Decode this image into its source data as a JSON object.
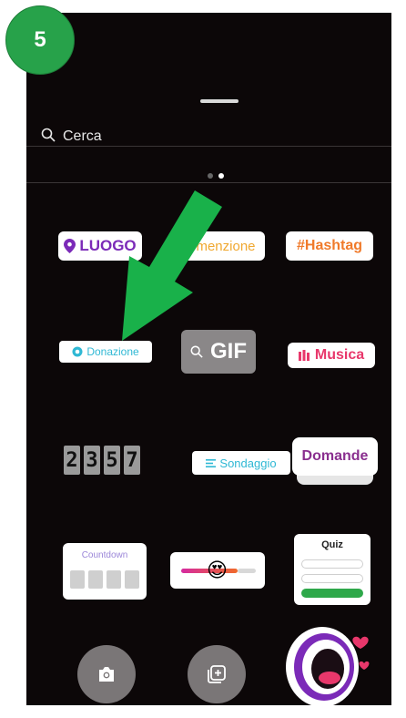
{
  "step_badge": "5",
  "search": {
    "placeholder": "Cerca",
    "icon": "search-icon"
  },
  "pager": {
    "pages": 2,
    "active": 2
  },
  "stickers": {
    "location": "LUOGO",
    "mention": "menzione",
    "hashtag": "#Hashtag",
    "donation": "Donazione",
    "gif": "GIF",
    "music": "Musica",
    "countdown_digits": [
      "2",
      "3",
      "5",
      "7"
    ],
    "poll": "Sondaggio",
    "questions": "Domande",
    "countdown_card": "Countdown",
    "quiz": "Quiz"
  },
  "bottom": {
    "camera_icon": "camera-icon",
    "add_icon": "add-media-icon",
    "shout_icon": "shout-sticker-icon"
  },
  "colors": {
    "background": "#0c0708",
    "badge": "#27a24a",
    "arrow": "#19b14a"
  }
}
